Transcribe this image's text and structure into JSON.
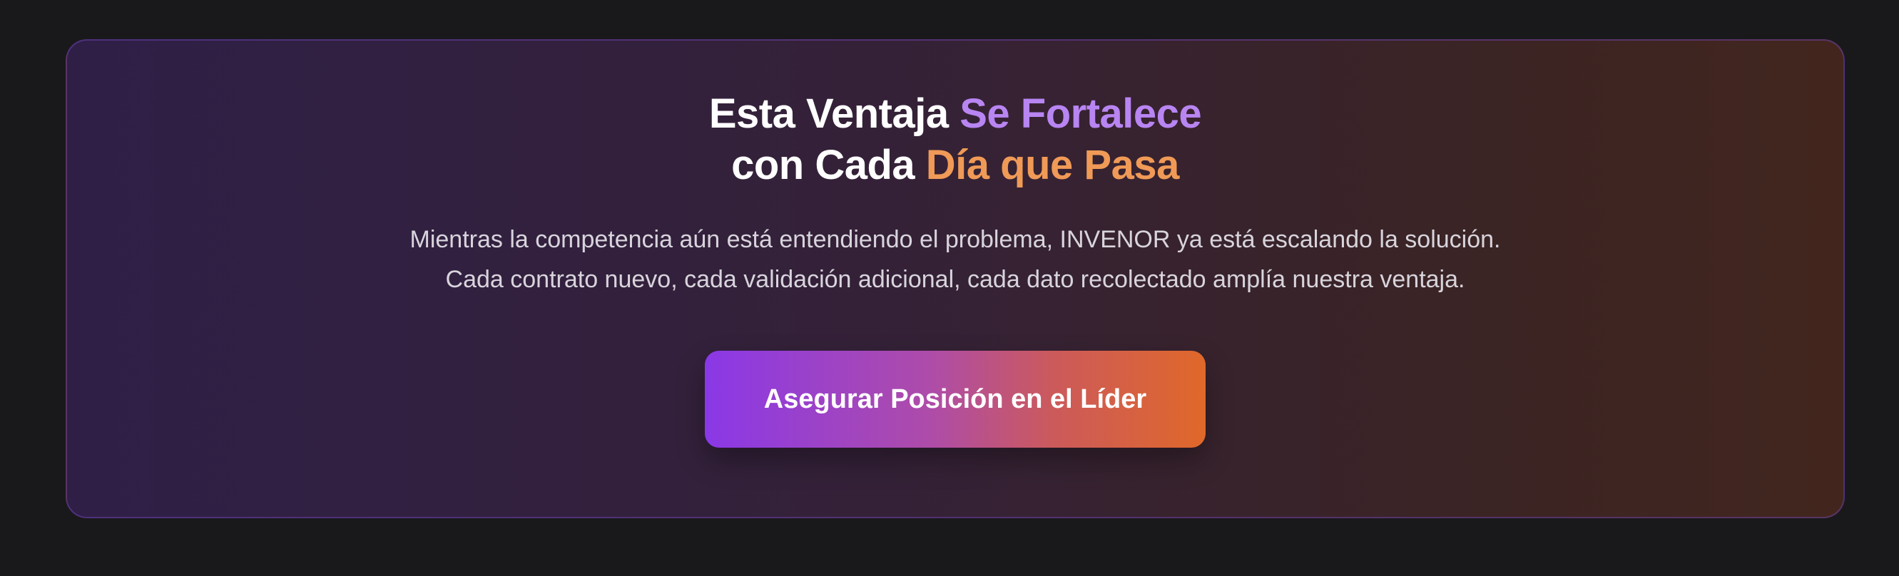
{
  "cta": {
    "title_line1_plain": "Esta Ventaja ",
    "title_line1_accent": "Se Fortalece",
    "title_line2_plain": "con Cada ",
    "title_line2_accent": "Día que Pasa",
    "description": "Mientras la competencia aún está entendiendo el problema, INVENOR ya está escalando la solución. Cada contrato nuevo, cada validación adicional, cada dato recolectado amplía nuestra ventaja.",
    "button_label": "Asegurar Posición en el Líder"
  },
  "colors": {
    "page_background": "#19191b",
    "accent_purple": "#b885f2",
    "accent_orange": "#f09a57",
    "button_gradient_start": "#8a38e7",
    "button_gradient_end": "#e0682a"
  }
}
